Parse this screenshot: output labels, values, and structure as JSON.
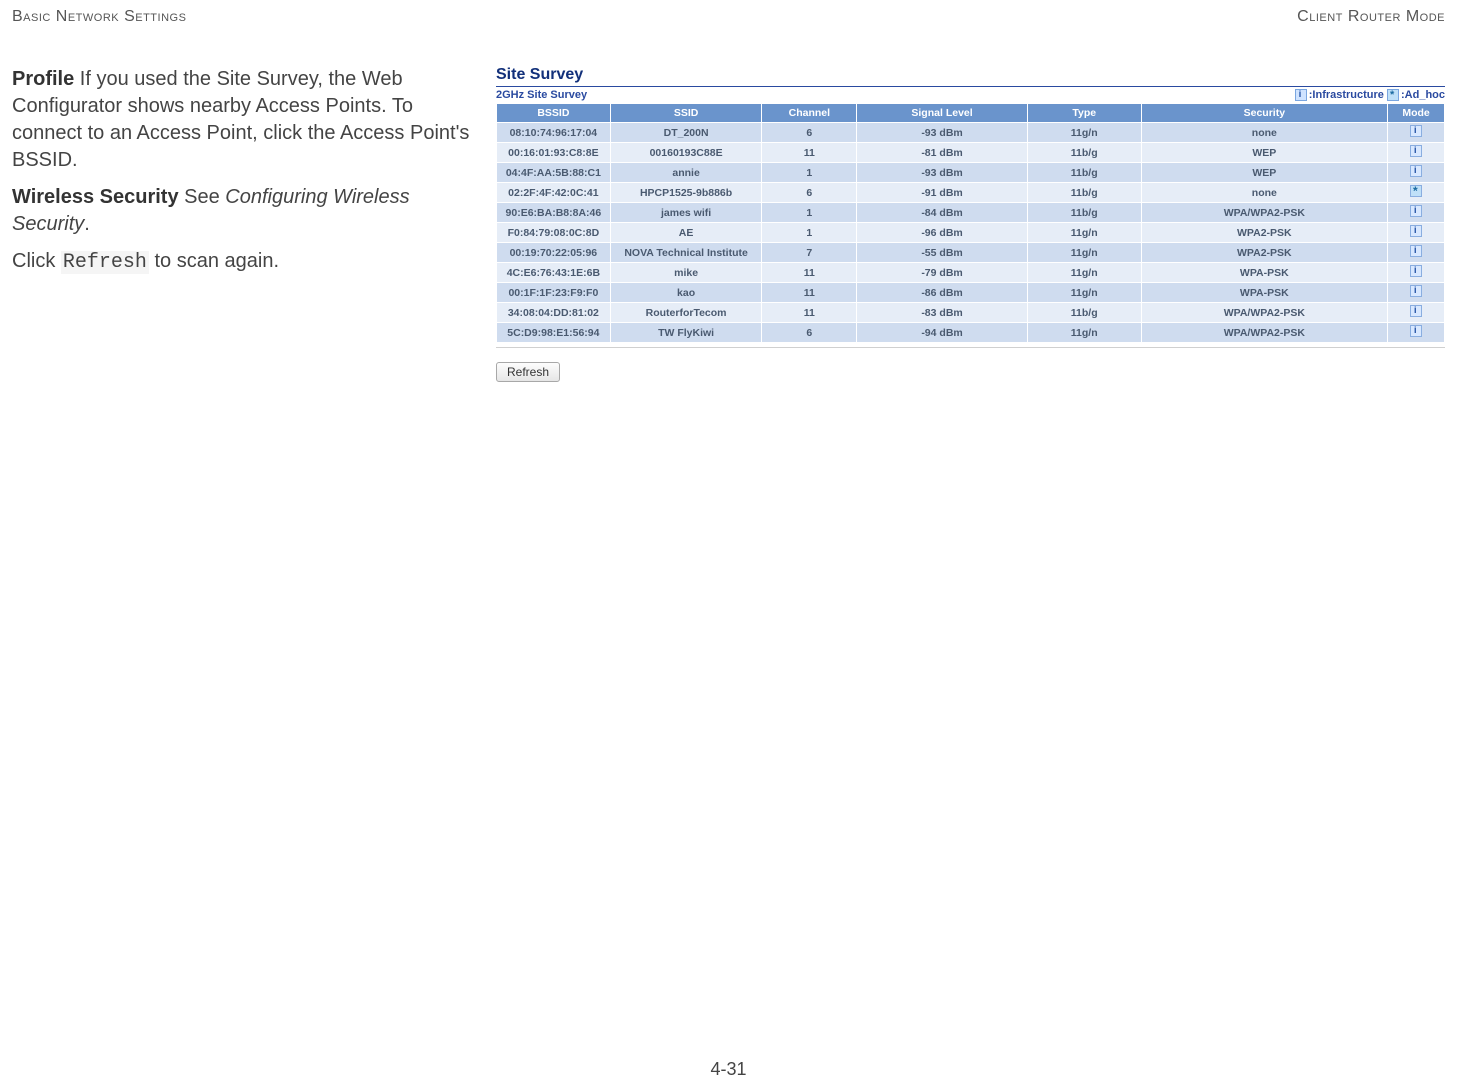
{
  "header": {
    "left": "Basic Network Settings",
    "right": "Client Router Mode"
  },
  "left": {
    "profile_label": "Profile",
    "profile_text": "  If you used the Site Survey, the Web Configurator shows nearby Access Points. To connect to an Access Point, click the Access Point's BSSID.",
    "ws_label": "Wireless Security",
    "ws_see": "  See ",
    "ws_ref": "Configuring Wireless Security",
    "ws_period": ".",
    "refresh_pre": "Click ",
    "refresh_code": "Refresh",
    "refresh_post": " to scan again."
  },
  "survey": {
    "title": "Site Survey",
    "subtitle": "2GHz Site Survey",
    "legend_infra": ":Infrastructure ",
    "legend_adhoc": ":Ad_hoc",
    "headers": [
      "BSSID",
      "SSID",
      "Channel",
      "Signal Level",
      "Type",
      "Security",
      "Mode"
    ],
    "rows": [
      {
        "bssid": "08:10:74:96:17:04",
        "ssid": "DT_200N",
        "chan": "6",
        "sig": "-93 dBm",
        "type": "11g/n",
        "sec": "none",
        "mode": "infra"
      },
      {
        "bssid": "00:16:01:93:C8:8E",
        "ssid": "00160193C88E",
        "chan": "11",
        "sig": "-81 dBm",
        "type": "11b/g",
        "sec": "WEP",
        "mode": "infra"
      },
      {
        "bssid": "04:4F:AA:5B:88:C1",
        "ssid": "annie",
        "chan": "1",
        "sig": "-93 dBm",
        "type": "11b/g",
        "sec": "WEP",
        "mode": "infra"
      },
      {
        "bssid": "02:2F:4F:42:0C:41",
        "ssid": "HPCP1525-9b886b",
        "chan": "6",
        "sig": "-91 dBm",
        "type": "11b/g",
        "sec": "none",
        "mode": "adhoc"
      },
      {
        "bssid": "90:E6:BA:B8:8A:46",
        "ssid": "james wifi",
        "chan": "1",
        "sig": "-84 dBm",
        "type": "11b/g",
        "sec": "WPA/WPA2-PSK",
        "mode": "infra"
      },
      {
        "bssid": "F0:84:79:08:0C:8D",
        "ssid": "AE",
        "chan": "1",
        "sig": "-96 dBm",
        "type": "11g/n",
        "sec": "WPA2-PSK",
        "mode": "infra"
      },
      {
        "bssid": "00:19:70:22:05:96",
        "ssid": "NOVA Technical Institute",
        "chan": "7",
        "sig": "-55 dBm",
        "type": "11g/n",
        "sec": "WPA2-PSK",
        "mode": "infra"
      },
      {
        "bssid": "4C:E6:76:43:1E:6B",
        "ssid": "mike",
        "chan": "11",
        "sig": "-79 dBm",
        "type": "11g/n",
        "sec": "WPA-PSK",
        "mode": "infra"
      },
      {
        "bssid": "00:1F:1F:23:F9:F0",
        "ssid": "kao",
        "chan": "11",
        "sig": "-86 dBm",
        "type": "11g/n",
        "sec": "WPA-PSK",
        "mode": "infra"
      },
      {
        "bssid": "34:08:04:DD:81:02",
        "ssid": "RouterforTecom",
        "chan": "11",
        "sig": "-83 dBm",
        "type": "11b/g",
        "sec": "WPA/WPA2-PSK",
        "mode": "infra"
      },
      {
        "bssid": "5C:D9:98:E1:56:94",
        "ssid": "TW FlyKiwi",
        "chan": "6",
        "sig": "-94 dBm",
        "type": "11g/n",
        "sec": "WPA/WPA2-PSK",
        "mode": "infra"
      }
    ],
    "refresh_label": "Refresh"
  },
  "footer": "4-31"
}
